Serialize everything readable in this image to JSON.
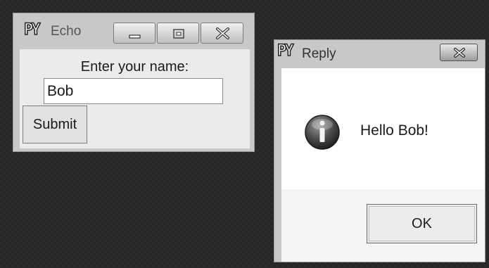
{
  "echo_window": {
    "title": "Echo",
    "logo_text": "PY",
    "prompt_label": "Enter your name:",
    "name_value": "Bob",
    "submit_label": "Submit"
  },
  "reply_window": {
    "title": "Reply",
    "logo_text": "PY",
    "message": "Hello Bob!",
    "ok_label": "OK",
    "icon": "info-icon"
  }
}
